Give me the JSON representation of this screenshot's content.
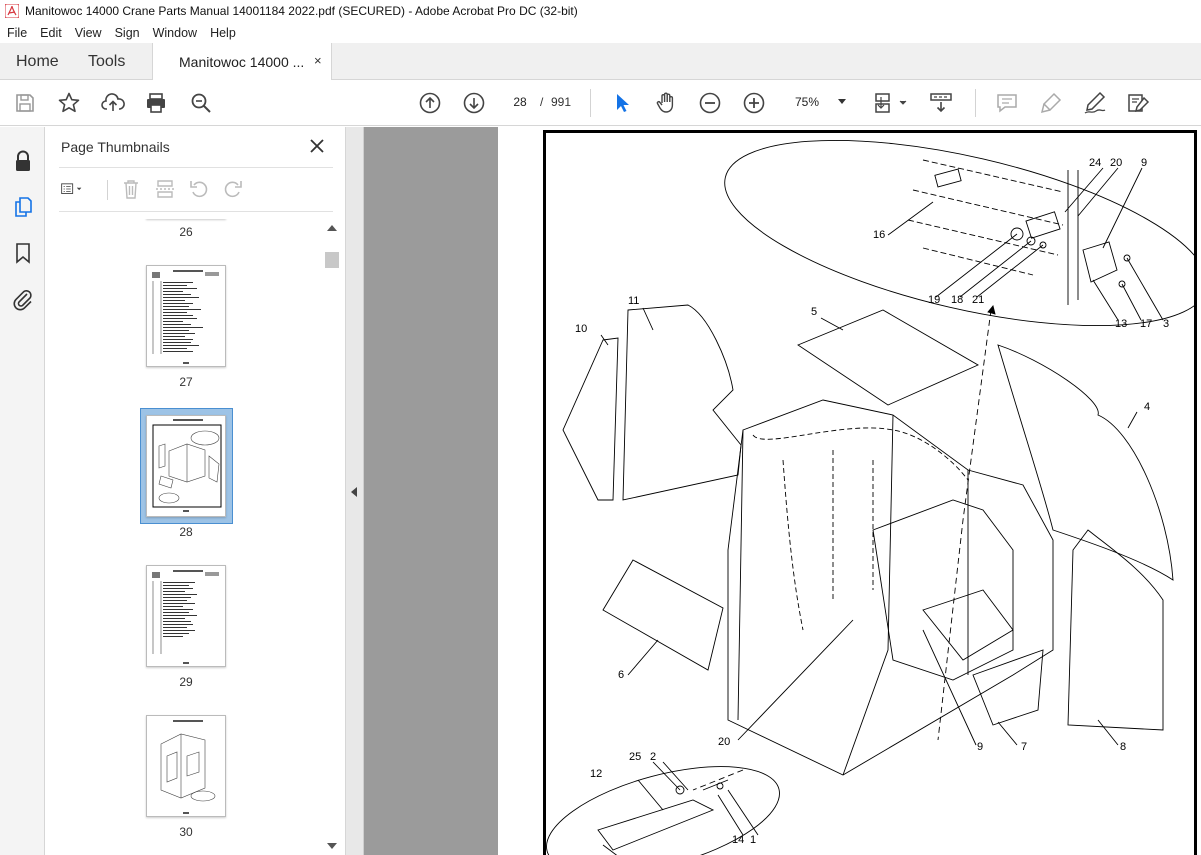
{
  "window": {
    "title": "Manitowoc 14000 Crane Parts Manual 14001184 2022.pdf (SECURED) - Adobe Acrobat Pro DC (32-bit)"
  },
  "menu": {
    "items": [
      "File",
      "Edit",
      "View",
      "Sign",
      "Window",
      "Help"
    ]
  },
  "tabs": {
    "home": "Home",
    "tools": "Tools",
    "document": "Manitowoc 14000 ...",
    "close": "×"
  },
  "toolbar": {
    "page_current": "28",
    "page_separator": "/",
    "page_total": "991",
    "zoom": "75%"
  },
  "icons": {
    "save": "save-icon",
    "bookmark_star": "star-icon",
    "upload": "upload-icon",
    "print": "print-icon",
    "zoom_search": "zoom-search-icon",
    "prev_page": "arrow-up-circle-icon",
    "next_page": "arrow-down-circle-icon",
    "select": "pointer-icon",
    "hand": "hand-icon",
    "zoom_out": "minus-circle-icon",
    "zoom_in": "plus-circle-icon",
    "fit": "page-fit-icon",
    "scroll_mode": "scroll-mode-icon",
    "comment": "comment-icon",
    "highlight": "highlighter-icon",
    "sign": "sign-icon",
    "edit": "edit-icon"
  },
  "panel": {
    "title": "Page Thumbnails",
    "thumbnails": [
      {
        "page": "26"
      },
      {
        "page": "27"
      },
      {
        "page": "28"
      },
      {
        "page": "29"
      },
      {
        "page": "30"
      }
    ]
  },
  "drawing": {
    "callouts": [
      "24",
      "20",
      "9",
      "16",
      "19",
      "18",
      "21",
      "13",
      "17",
      "3",
      "11",
      "5",
      "10",
      "4",
      "6",
      "20",
      "9",
      "7",
      "8",
      "25",
      "2",
      "12",
      "14",
      "1"
    ]
  }
}
